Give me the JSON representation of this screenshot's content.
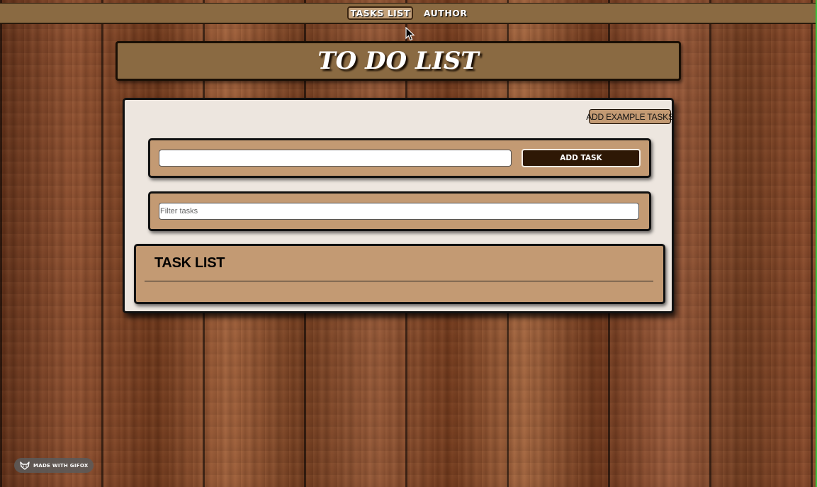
{
  "nav": {
    "tasks_list": "TASKS LIST",
    "author": "AUTHOR",
    "active": "tasks_list"
  },
  "header": {
    "title": "TO DO LIST"
  },
  "actions": {
    "add_examples_label": "ADD EXAMPLE TASKS"
  },
  "add_task": {
    "input_value": "",
    "button_label": "ADD TASK"
  },
  "filter": {
    "placeholder": "Filter tasks",
    "value": ""
  },
  "task_list": {
    "title": "TASK LIST",
    "items": []
  },
  "badge": {
    "label": "MADE WITH GIFOX",
    "icon": "fox-icon"
  },
  "colors": {
    "panel_tan": "#c39a73",
    "nav_brown": "#8a6a42",
    "dark_button": "#2e1805",
    "panel_light": "#ede6df"
  }
}
